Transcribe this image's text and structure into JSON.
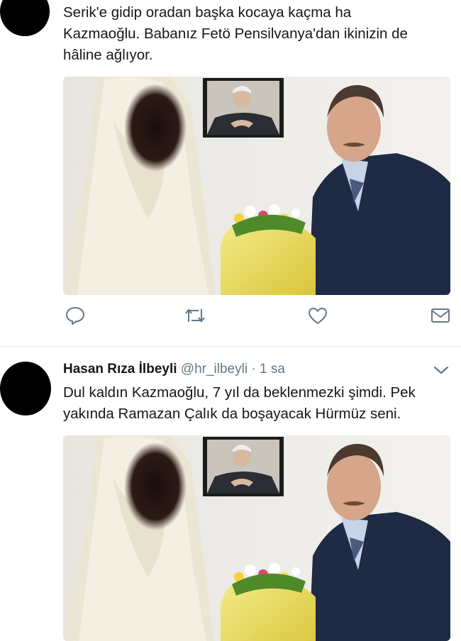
{
  "tweet1": {
    "lines": [
      "Serik'e gidip oradan başka kocaya kaçma ha",
      "Kazmaoğlu. Babanız Fetö Pensilvanya'dan ikinizin de",
      "hâline ağlıyor."
    ]
  },
  "actions": [
    "reply-icon",
    "retweet-icon",
    "like-icon",
    "message-icon"
  ],
  "tweet2": {
    "author_name": "Hasan Rıza İlbeyli",
    "author_handle": "@hr_ilbeyli",
    "separator": "·",
    "time": "1 sa",
    "lines": [
      "Dul kaldın Kazmaoğlu, 7 yıl da beklenmezki şimdi. Pek",
      "yakında Ramazan Çalık da boşayacak Hürmüz seni."
    ]
  },
  "colors": {
    "text": "#14171a",
    "secondary": "#657786",
    "divider": "#e1e8ed"
  }
}
